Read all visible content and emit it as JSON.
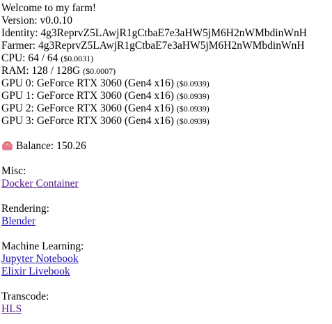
{
  "header": {
    "welcome": "Welcome to my farm!"
  },
  "info": {
    "version_label": "Version:",
    "version": "v0.0.10",
    "identity_label": "Identity:",
    "identity": "4g3ReprvZ5LAwjR1gCtbaE7e3aHW5jM6H2nWMbdinWnH",
    "farmer_label": "Farmer:",
    "farmer": "4g3ReprvZ5LAwjR1gCtbaE7e3aHW5jM6H2nWMbdinWnH",
    "cpu_label": "CPU:",
    "cpu": "64 / 64",
    "cpu_price": "($0.0031)",
    "ram_label": "RAM:",
    "ram": "128 / 128G",
    "ram_price": "($0.0007)"
  },
  "gpus": [
    {
      "label": "GPU 0:",
      "name": "GeForce RTX 3060 (Gen4 x16)",
      "price": "($0.0939)"
    },
    {
      "label": "GPU 1:",
      "name": "GeForce RTX 3060 (Gen4 x16)",
      "price": "($0.0939)"
    },
    {
      "label": "GPU 2:",
      "name": "GeForce RTX 3060 (Gen4 x16)",
      "price": "($0.0939)"
    },
    {
      "label": "GPU 3:",
      "name": "GeForce RTX 3060 (Gen4 x16)",
      "price": "($0.0939)"
    }
  ],
  "balance": {
    "icon": "purse-icon",
    "label": "Balance:",
    "value": "150.26"
  },
  "sections": {
    "misc": {
      "heading": "Misc:",
      "links": [
        "Docker Container"
      ]
    },
    "rendering": {
      "heading": "Rendering:",
      "links": [
        "Blender"
      ]
    },
    "ml": {
      "heading": "Machine Learning:",
      "links": [
        "Jupyter Notebook",
        "Elixir Livebook"
      ]
    },
    "transcode": {
      "heading": "Transcode:",
      "links": [
        "HLS"
      ]
    }
  },
  "colors": {
    "link": "#1a0dab",
    "visited_link": "#551a8b",
    "text": "#000000",
    "purse": "#e8738f"
  }
}
